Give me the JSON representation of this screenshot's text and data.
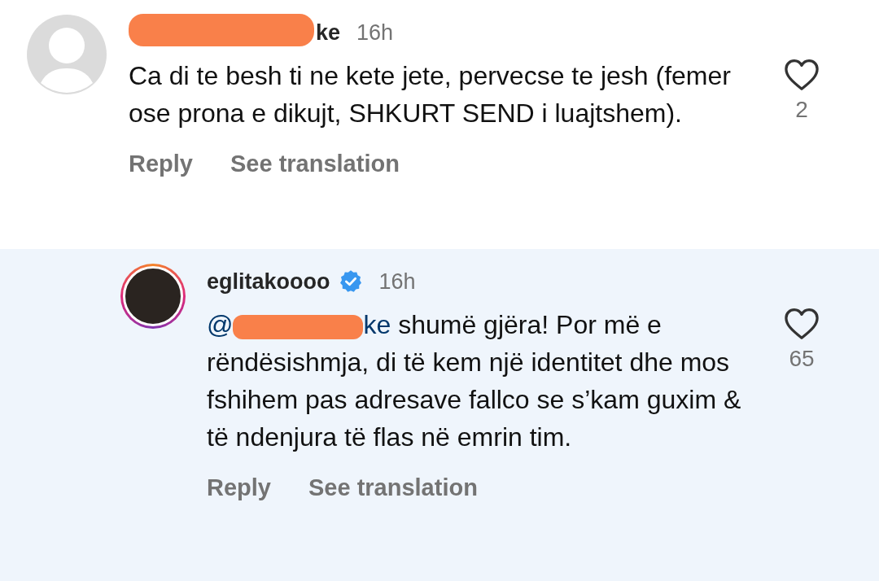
{
  "comments": [
    {
      "kind": "comment",
      "verified": false,
      "highlighted": false,
      "username": "ke",
      "time": "16h",
      "text": "Ca di te besh ti ne kete jete, pervecse te jesh (femer ose prona e dikujt, SHKURT SEND i luajtshem).",
      "likes": "2",
      "liked": false,
      "actions": [
        "Reply",
        "See translation"
      ]
    },
    {
      "kind": "reply",
      "verified": true,
      "highlighted": true,
      "username": "eglitakoooo",
      "time": "16h",
      "mention_prefix": "@",
      "mention_suffix": "ke",
      "text": " shumë gjëra! Por më e rëndësishmja, di të kem një identitet dhe mos fshihem pas adresave fallco se s’kam guxim & të ndenjura të flas në emrin tim.",
      "likes": "65",
      "liked": false,
      "actions": [
        "Reply",
        "See translation"
      ]
    }
  ]
}
